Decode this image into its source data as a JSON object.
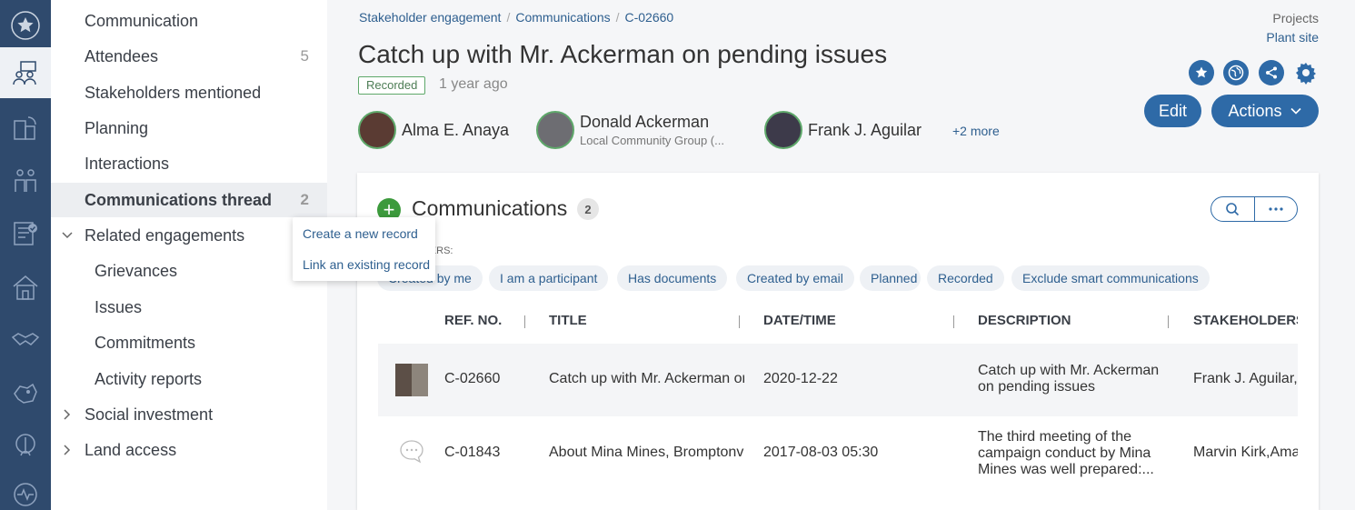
{
  "rail": {
    "items": [
      {
        "icon": "star-icon"
      },
      {
        "icon": "stakeholder-engagement-icon"
      },
      {
        "icon": "buildings-icon"
      },
      {
        "icon": "people-icon"
      },
      {
        "icon": "checklist-icon"
      },
      {
        "icon": "house-icon"
      },
      {
        "icon": "handshake-icon"
      },
      {
        "icon": "map-icon"
      },
      {
        "icon": "plant-icon"
      },
      {
        "icon": "activity-icon"
      }
    ]
  },
  "subnav": {
    "items": [
      {
        "label": "Communication",
        "count": ""
      },
      {
        "label": "Attendees",
        "count": "5"
      },
      {
        "label": "Stakeholders mentioned",
        "count": ""
      },
      {
        "label": "Planning",
        "count": ""
      },
      {
        "label": "Interactions",
        "count": ""
      },
      {
        "label": "Communications thread",
        "count": "2"
      },
      {
        "label": "Related engagements",
        "count": ""
      },
      {
        "label": "Grievances",
        "count": ""
      },
      {
        "label": "Issues",
        "count": ""
      },
      {
        "label": "Commitments",
        "count": ""
      },
      {
        "label": "Activity reports",
        "count": ""
      },
      {
        "label": "Social investment",
        "count": ""
      },
      {
        "label": "Land access",
        "count": ""
      }
    ]
  },
  "header": {
    "breadcrumb": [
      "Stakeholder engagement",
      "Communications",
      "C-02660"
    ],
    "project_label": "Projects",
    "project_value": "Plant site",
    "title": "Catch up with Mr. Ackerman on pending issues",
    "status": "Recorded",
    "time": "1 year ago",
    "people": [
      {
        "name": "Alma E. Anaya",
        "sub": ""
      },
      {
        "name": "Donald Ackerman",
        "sub": "Local Community Group (..."
      },
      {
        "name": "Frank J. Aguilar",
        "sub": ""
      }
    ],
    "more": "+2 more",
    "edit_label": "Edit",
    "actions_label": "Actions"
  },
  "card": {
    "title": "Communications",
    "count": "2",
    "filters_label": "FILTERS:",
    "chips": [
      "Created by me",
      "I am a participant",
      "Has documents",
      "Created by email",
      "Planned",
      "Recorded",
      "Exclude smart communications"
    ],
    "columns": [
      "REF. NO.",
      "TITLE",
      "DATE/TIME",
      "DESCRIPTION",
      "STAKEHOLDERS"
    ],
    "rows": [
      {
        "ref": "C-02660",
        "title": "Catch up with Mr. Ackerman or",
        "date": "2020-12-22",
        "desc": "Catch up with Mr. Ackerman on pending issues",
        "stakeholders": "Frank J. Aguilar,D"
      },
      {
        "ref": "C-01843",
        "title": "About Mina Mines, Bromptonvi",
        "date": "2017-08-03 05:30",
        "desc": "The third meeting of the campaign conduct by Mina Mines was well prepared:...",
        "stakeholders": "Marvin Kirk,Ama"
      }
    ]
  },
  "dropdown": {
    "options": [
      "Create a new record",
      "Link an existing record"
    ]
  },
  "colors": {
    "rail": "#2f4a6d",
    "accent": "#2e6aa7",
    "green": "#3c9a3c"
  }
}
